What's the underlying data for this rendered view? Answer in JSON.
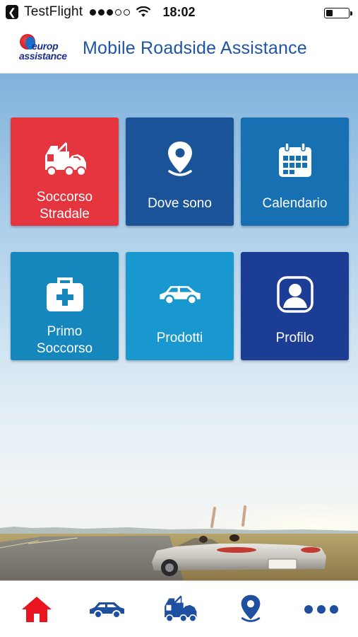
{
  "status_bar": {
    "back_app": "TestFlight",
    "time": "18:02",
    "signal_bars": 5,
    "signal_filled": 3,
    "battery_level": 0.3
  },
  "header": {
    "logo_line1": "europ",
    "logo_line2": "assistance",
    "title": "Mobile Roadside Assistance"
  },
  "tiles": [
    {
      "label": "Soccorso\nStradale",
      "icon": "tow-truck-icon",
      "color": "#e4343d"
    },
    {
      "label": "Dove sono",
      "icon": "location-pin-icon",
      "color": "#1b5399"
    },
    {
      "label": "Calendario",
      "icon": "calendar-icon",
      "color": "#1670b2"
    },
    {
      "label": "Primo\nSoccorso",
      "icon": "first-aid-kit-icon",
      "color": "#1687bd"
    },
    {
      "label": "Prodotti",
      "icon": "car-icon",
      "color": "#1898cf"
    },
    {
      "label": "Profilo",
      "icon": "profile-icon",
      "color": "#1c3d94"
    }
  ],
  "tabbar": {
    "items": [
      {
        "name": "home",
        "icon": "home-icon",
        "active": true
      },
      {
        "name": "car",
        "icon": "car-icon",
        "active": false
      },
      {
        "name": "tow",
        "icon": "tow-truck-icon",
        "active": false
      },
      {
        "name": "location",
        "icon": "location-pin-icon",
        "active": false
      },
      {
        "name": "more",
        "icon": "more-icon",
        "active": false
      }
    ],
    "active_color": "#e8141f",
    "inactive_color": "#1e4fa1"
  },
  "colors": {
    "brand_blue": "#1e55a4",
    "brand_red": "#e4343d"
  }
}
